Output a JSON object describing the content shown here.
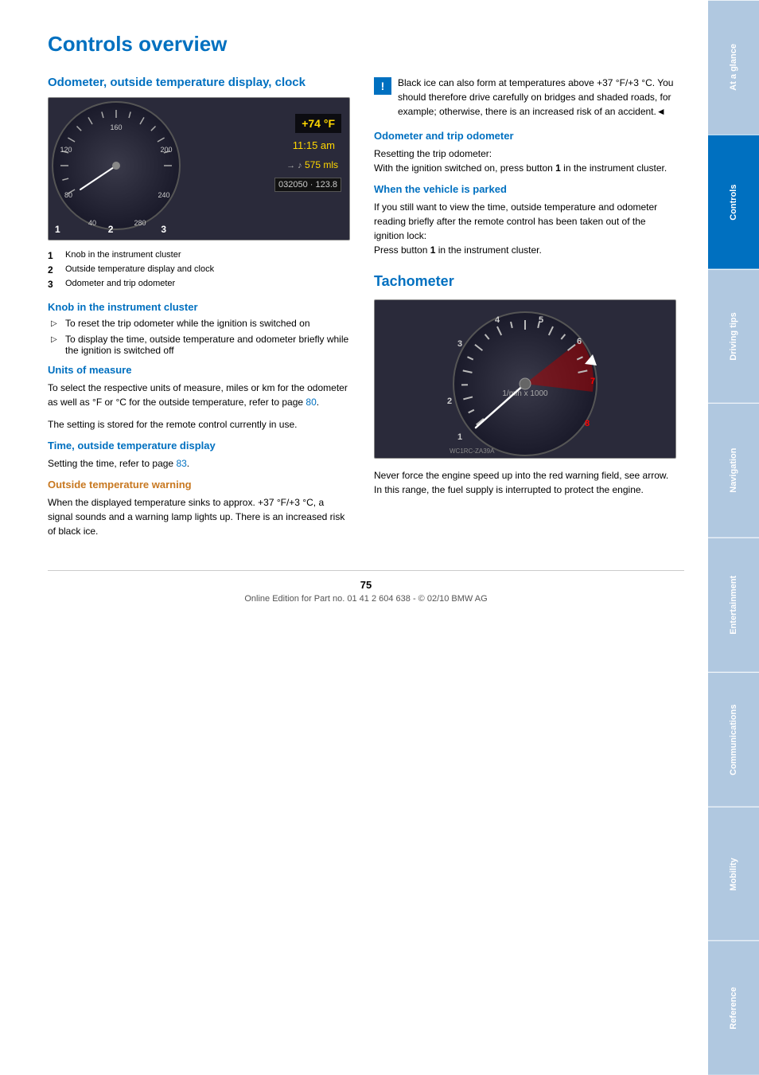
{
  "page": {
    "title": "Controls overview",
    "footer_page_number": "75",
    "footer_text": "Online Edition for Part no. 01 41 2 604 638 - © 02/10 BMW AG"
  },
  "sidebar": {
    "tabs": [
      {
        "label": "At a glance",
        "active": false
      },
      {
        "label": "Controls",
        "active": true
      },
      {
        "label": "Driving tips",
        "active": false
      },
      {
        "label": "Navigation",
        "active": false
      },
      {
        "label": "Entertainment",
        "active": false
      },
      {
        "label": "Communications",
        "active": false
      },
      {
        "label": "Mobility",
        "active": false
      },
      {
        "label": "Reference",
        "active": false
      }
    ]
  },
  "section_odometer": {
    "title": "Odometer, outside temperature display, clock",
    "cluster": {
      "temp": "+74 °F",
      "time": "11:15 am",
      "dist": "→🔊  575 mls",
      "odo": "032050 · 123.8"
    },
    "labels": [
      {
        "num": "1",
        "text": "Knob in the instrument cluster"
      },
      {
        "num": "2",
        "text": "Outside temperature display and clock"
      },
      {
        "num": "3",
        "text": "Odometer and trip odometer"
      }
    ]
  },
  "subsection_knob": {
    "title": "Knob in the instrument cluster",
    "bullets": [
      "To reset the trip odometer while the ignition is switched on",
      "To display the time, outside temperature and odometer briefly while the ignition is switched off"
    ]
  },
  "subsection_units": {
    "title": "Units of measure",
    "text": "To select the respective units of measure, miles or km for the odometer as well as °F or °C for the outside temperature, refer to page 80.",
    "text2": "The setting is stored for the remote control currently in use.",
    "link_page": "80"
  },
  "subsection_time": {
    "title": "Time, outside temperature display",
    "text": "Setting the time, refer to page 83.",
    "link_page": "83"
  },
  "subsection_outside_temp_warning": {
    "title": "Outside temperature warning",
    "text": "When the displayed temperature sinks to approx. +37 °F/+3 °C, a signal sounds and a warning lamp lights up. There is an increased risk of black ice."
  },
  "warning_box": {
    "text": "Black ice can also form at temperatures above +37 °F/+3 °C. You should therefore drive carefully on bridges and shaded roads, for example; otherwise, there is an increased risk of an accident.◄"
  },
  "subsection_odometer_trip": {
    "title": "Odometer and trip odometer",
    "text": "Resetting the trip odometer:\nWith the ignition switched on, press button 1 in the instrument cluster."
  },
  "subsection_when_parked": {
    "title": "When the vehicle is parked",
    "text": "If you still want to view the time, outside temperature and odometer reading briefly after the remote control has been taken out of the ignition lock:\nPress button 1 in the instrument cluster."
  },
  "section_tachometer": {
    "title": "Tachometer",
    "text": "Never force the engine speed up into the red warning field, see arrow. In this range, the fuel supply is interrupted to protect the engine."
  }
}
